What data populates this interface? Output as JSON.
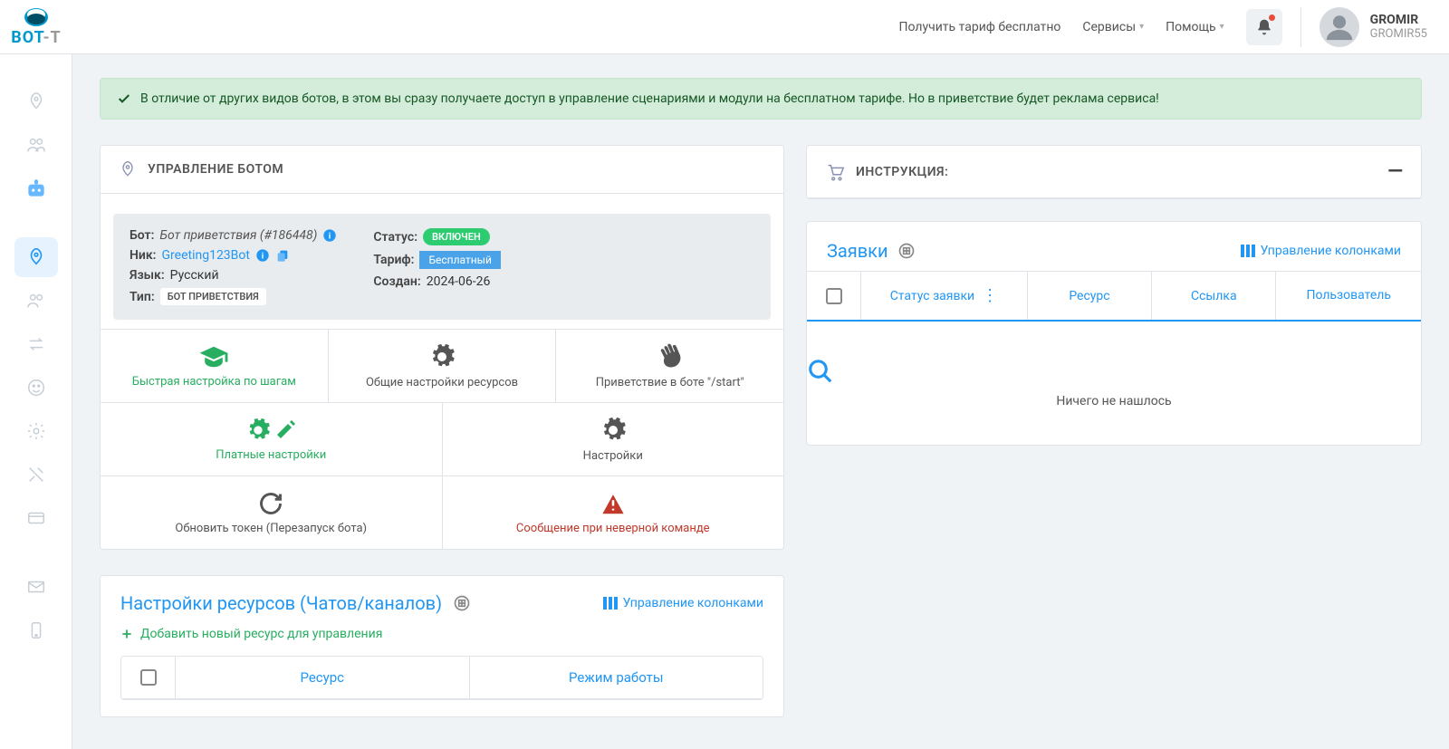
{
  "topbar": {
    "tariff_link": "Получить тариф бесплатно",
    "services": "Сервисы",
    "help": "Помощь"
  },
  "user": {
    "name": "GROMIR",
    "handle": "GROMIR55"
  },
  "alert": {
    "text": "В отличие от других видов ботов, в этом вы сразу получаете доступ в управление сценариями и модули на бесплатном тарифе. Но в приветствие будет реклама сервиса!"
  },
  "bot_panel": {
    "title": "УПРАВЛЕНИЕ БОТОМ",
    "info": {
      "bot_lbl": "Бот:",
      "bot_val": "Бот приветствия (#186448)",
      "nick_lbl": "Ник:",
      "nick_val": "Greeting123Bot",
      "lang_lbl": "Язык:",
      "lang_val": "Русский",
      "type_lbl": "Тип:",
      "type_val": "БОТ ПРИВЕТСТВИЯ",
      "status_lbl": "Статус:",
      "status_val": "ВКЛЮЧЕН",
      "tariff_lbl": "Тариф:",
      "tariff_val": "Бесплатный",
      "created_lbl": "Создан:",
      "created_val": "2024-06-26"
    },
    "tiles": {
      "quick": "Быстрая настройка по шагам",
      "general": "Общие настройки ресурсов",
      "greeting": "Приветствие в боте \"/start\"",
      "paid": "Платные настройки",
      "settings": "Настройки",
      "token": "Обновить токен (Перезапуск бота)",
      "invalid": "Сообщение при неверной команде"
    }
  },
  "resources": {
    "title": "Настройки ресурсов (Чатов/каналов)",
    "columns_ctrl": "Управление колонками",
    "add": "Добавить новый ресурс для управления",
    "th_resource": "Ресурс",
    "th_mode": "Режим работы"
  },
  "instruction": {
    "title": "ИНСТРУКЦИЯ:"
  },
  "requests": {
    "title": "Заявки",
    "columns_ctrl": "Управление колонками",
    "th_status": "Статус заявки",
    "th_resource": "Ресурс",
    "th_link": "Ссылка",
    "th_user": "Пользователь",
    "empty": "Ничего не нашлось"
  }
}
